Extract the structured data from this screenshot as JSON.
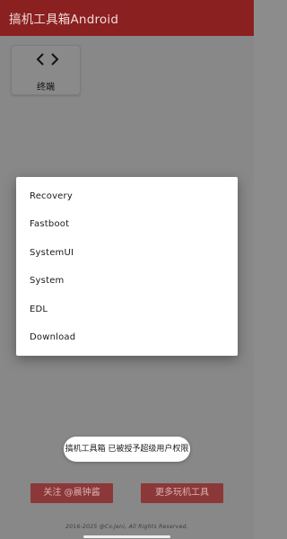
{
  "app": {
    "title": "搞机工具箱Android"
  },
  "tools": [
    {
      "label": "终端",
      "icon": "code-icon"
    }
  ],
  "dialog": {
    "items": [
      "Recovery",
      "Fastboot",
      "SystemUI",
      "System",
      "EDL",
      "Download"
    ]
  },
  "toast": {
    "text": "搞机工具箱 已被授予超级用户权限"
  },
  "buttons": {
    "follow": "关注 @晨钟酱",
    "more": "更多玩机工具"
  },
  "footer": {
    "text": "2016-2025 @Cv.Jeni, All Rights Reserved."
  },
  "colors": {
    "appbar": "#8a2020",
    "scrim_background": "#888888",
    "button": "#8c3838",
    "dialog": "#ffffff"
  }
}
